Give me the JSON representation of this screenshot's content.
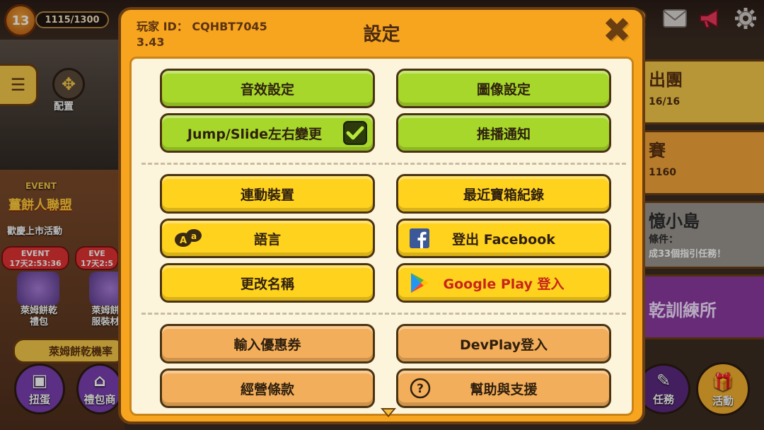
{
  "background": {
    "level": "13",
    "energy": "1115/1300",
    "layout_label": "配置",
    "event_tag_1": "EVENT",
    "event_logo": "薑餅人聯盟",
    "event_subtitle": "歡慶上市活動",
    "timer_tag_1": "EVENT",
    "timer_1": "17天2:53:36",
    "timer_tag_2": "EVE",
    "timer_2": "17天2:5",
    "shop_item_1": "萊姆餅乾\n禮包",
    "shop_item_2": "萊姆餅\n服裝材",
    "banner_left": "萊姆餅乾機率",
    "gacha_label": "扭蛋",
    "giftshop_label": "禮包商",
    "right_panel_1_title": "出團",
    "right_panel_1_sub": "16/16",
    "right_panel_2_title": "賽",
    "right_panel_2_sub": "1160",
    "right_panel_3_title": "憶小島",
    "right_panel_3_sub_1": "條件：",
    "right_panel_3_sub_2": "成33個指引任務！",
    "right_panel_4_title": "乾訓練所",
    "mission_label": "任務",
    "event_label": "活動",
    "top_icons": [
      "cookie-icon",
      "mail-icon",
      "megaphone-icon",
      "gear-icon"
    ]
  },
  "modal": {
    "player_id": "玩家 ID： CQHBT7045",
    "version": "3.43",
    "title": "設定",
    "close_glyph": "✖",
    "section_1": {
      "sound_settings": "音效設定",
      "graphics_settings": "圖像設定",
      "jump_slide": "Jump/Slide左右變更",
      "jump_slide_checked": true,
      "push_notifications": "推播通知"
    },
    "section_2": {
      "linked_devices": "連動裝置",
      "chest_history": "最近寶箱紀錄",
      "language": "語言",
      "facebook_logout": "登出 Facebook",
      "change_name": "更改名稱",
      "google_play_login": "Google Play 登入"
    },
    "section_3": {
      "coupon": "輸入優惠券",
      "devplay_login": "DevPlay登入",
      "terms": "經營條款",
      "help_support": "幫助與支援"
    }
  },
  "colors": {
    "modal_frame": "#f7a51f",
    "green_button": "#a6d72a",
    "yellow_button": "#ffd21e",
    "orange_button": "#f3ae5b",
    "google_play_text": "#c7251a"
  }
}
